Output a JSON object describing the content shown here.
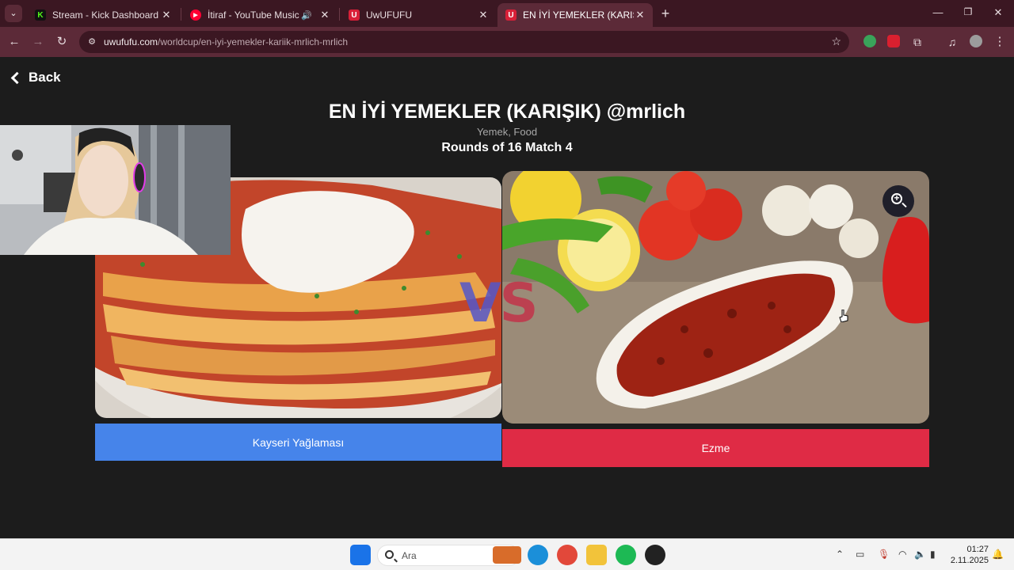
{
  "browser": {
    "tabs": [
      {
        "title": "Stream - Kick Dashboard",
        "favicon": "K",
        "favicon_color": "#53fc18",
        "active": false
      },
      {
        "title": "İtiraf - YouTube Music",
        "favicon": "▶",
        "favicon_color": "#ff0033",
        "active": false,
        "playing_audio": true
      },
      {
        "title": "UwUFUFU",
        "favicon": "U",
        "favicon_color": "#d92038",
        "active": false
      },
      {
        "title": "EN İYİ YEMEKLER (KARIŞIK) @mrlich",
        "favicon": "U",
        "favicon_color": "#d92038",
        "active": true
      }
    ],
    "url_host": "uwufufu.com",
    "url_path": "/worldcup/en-iyi-yemekler-kariik-mrlich-mrlich"
  },
  "page": {
    "back_label": "Back",
    "title": "EN İYİ YEMEKLER (KARIŞIK) @mrlich",
    "category": "Yemek, Food",
    "round": "Rounds of 16 Match 4",
    "vs_v": "V",
    "vs_s": "S",
    "left_choice": "Kayseri Yağlaması",
    "right_choice": "Ezme",
    "colors": {
      "left_button": "#4684ea",
      "right_button": "#df2b45",
      "background": "#1c1c1c"
    }
  },
  "taskbar": {
    "search_placeholder": "Ara",
    "time": "01:27",
    "date": "2.11.2025"
  }
}
